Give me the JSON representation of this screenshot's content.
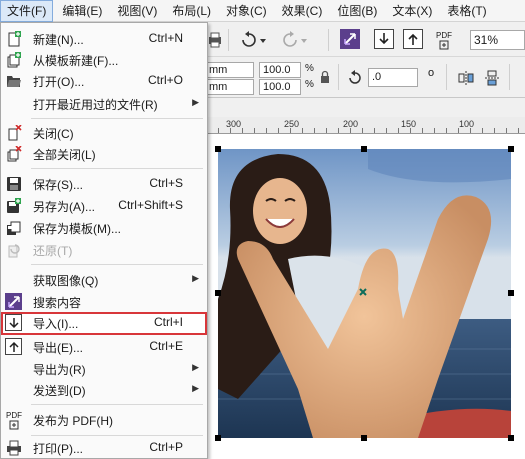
{
  "menubar": {
    "items": [
      {
        "label": "文件(F)",
        "active": true
      },
      {
        "label": "编辑(E)"
      },
      {
        "label": "视图(V)"
      },
      {
        "label": "布局(L)"
      },
      {
        "label": "对象(C)"
      },
      {
        "label": "效果(C)"
      },
      {
        "label": "位图(B)"
      },
      {
        "label": "文本(X)"
      },
      {
        "label": "表格(T)"
      }
    ]
  },
  "toolbar": {
    "zoom_value": "31%",
    "pdf_label": "PDF",
    "unit_x": "mm",
    "unit_y": "mm",
    "scale_x": "100.0",
    "scale_y": "100.0",
    "percent_x": "%",
    "percent_y": "%",
    "rotation_value": ".0",
    "degree_symbol": "o"
  },
  "ruler": {
    "labels": [
      "300",
      "250",
      "200",
      "150",
      "100"
    ]
  },
  "file_menu": {
    "items": [
      {
        "label": "新建(N)...",
        "shortcut": "Ctrl+N",
        "icon": "new-document-icon"
      },
      {
        "label": "从模板新建(F)...",
        "shortcut": "",
        "icon": "new-from-template-icon"
      },
      {
        "label": "打开(O)...",
        "shortcut": "Ctrl+O",
        "icon": "open-folder-icon"
      },
      {
        "label": "打开最近用过的文件(R)",
        "shortcut": "",
        "submenu": true
      },
      {
        "label": "关闭(C)",
        "shortcut": "",
        "icon": "close-document-icon"
      },
      {
        "label": "全部关闭(L)",
        "shortcut": "",
        "icon": "close-all-icon"
      },
      {
        "label": "保存(S)...",
        "shortcut": "Ctrl+S",
        "icon": "save-icon"
      },
      {
        "label": "另存为(A)...",
        "shortcut": "Ctrl+Shift+S",
        "icon": "save-as-icon"
      },
      {
        "label": "保存为模板(M)...",
        "shortcut": "",
        "icon": "save-as-template-icon"
      },
      {
        "label": "还原(T)",
        "shortcut": "",
        "icon": "revert-icon",
        "disabled": true
      },
      {
        "label": "获取图像(Q)",
        "shortcut": "",
        "submenu": true
      },
      {
        "label": "搜索内容",
        "shortcut": "",
        "icon": "search-content-icon"
      },
      {
        "label": "导入(I)...",
        "shortcut": "Ctrl+I",
        "icon": "import-icon",
        "highlighted": true
      },
      {
        "label": "导出(E)...",
        "shortcut": "Ctrl+E",
        "icon": "export-icon"
      },
      {
        "label": "导出为(R)",
        "shortcut": "",
        "submenu": true
      },
      {
        "label": "发送到(D)",
        "shortcut": "",
        "submenu": true
      },
      {
        "label": "发布为 PDF(H)",
        "shortcut": "",
        "icon": "publish-pdf-icon"
      },
      {
        "label": "打印(P)...",
        "shortcut": "Ctrl+P",
        "icon": "print-icon"
      }
    ],
    "pdf_icon_text": "PDF"
  },
  "colors": {
    "highlight_border": "#d8363a",
    "menu_active_bg": "#dbe9f8",
    "accent_purple": "#5b3f8c"
  }
}
